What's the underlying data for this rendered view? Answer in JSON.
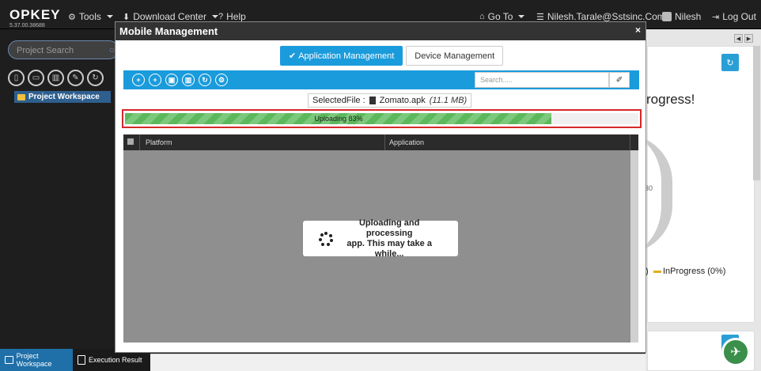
{
  "app": {
    "logo": "OPKEY",
    "version": "5.37.00.38688",
    "nav": {
      "tools": "Tools",
      "download_center": "Download Center",
      "help": "Help",
      "go_to": "Go To",
      "user_email": "Nilesh.Tarale@Sstsinc.Com",
      "user_name": "Nilesh",
      "logout": "Log Out"
    }
  },
  "sidebar": {
    "search_placeholder": "Project Search",
    "workspace_item": "Project Workspace",
    "bottom_tabs": [
      "Project Workspace",
      "Execution Result"
    ]
  },
  "background": {
    "progress_heading": "rogress!",
    "gauge_tick_1": "30",
    "gauge_tick_2": "0",
    "legend_prefix": ")",
    "legend_inprogress": "InProgress (0%)"
  },
  "modal": {
    "title": "Mobile Management",
    "close": "×",
    "tabs": {
      "application": "Application Management",
      "device": "Device Management"
    },
    "search_placeholder": "Search.....",
    "selected_file": {
      "label": "SelectedFile :",
      "name": "Zomato.apk",
      "size": "(11.1 MB)"
    },
    "upload": {
      "label": "Uploading 83%",
      "percent": 83
    },
    "table": {
      "columns": [
        "Platform",
        "Application"
      ]
    },
    "loader_text_line1": "Uploading and processing",
    "loader_text_line2": "app. This may take a while..."
  },
  "colors": {
    "accent": "#1a9bdc",
    "progress_green": "#5cb85c",
    "highlight_red": "#d62828"
  }
}
